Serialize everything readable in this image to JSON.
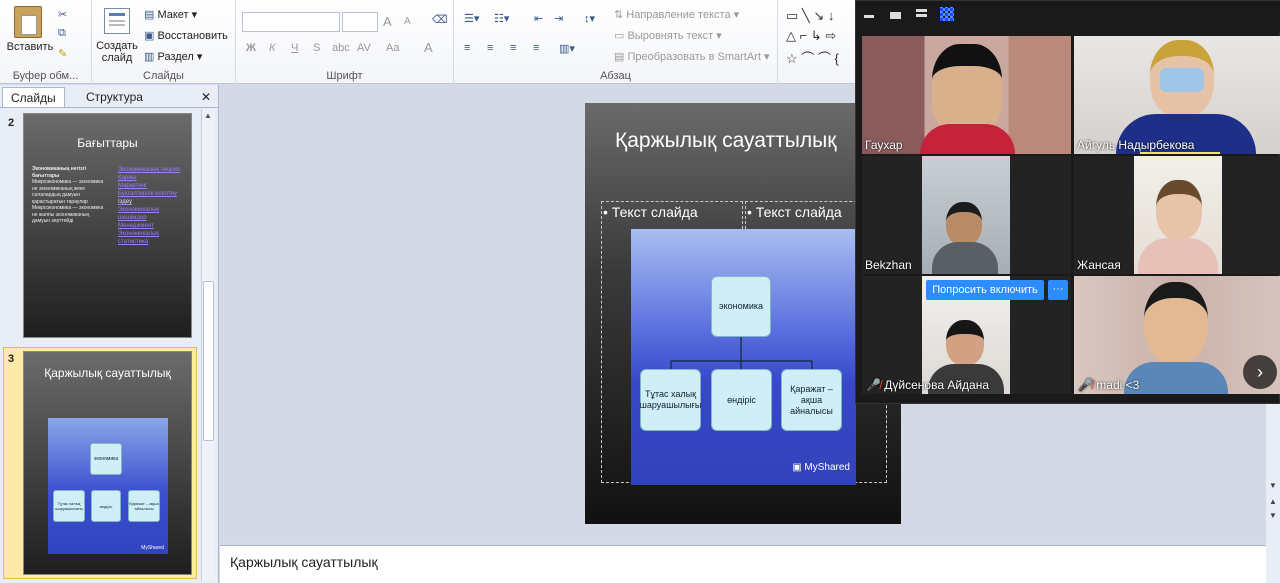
{
  "ribbon": {
    "paste_label": "Вставить",
    "clipboard_group": "Буфер обм...",
    "new_slide_label": "Создать слайд",
    "layout_label": "Макет",
    "reset_label": "Восстановить",
    "section_label": "Раздел",
    "slides_group": "Слайды",
    "bold": "Ж",
    "italic": "К",
    "underline": "Ч",
    "strike": "S",
    "shadow": "abc",
    "spacing": "AV",
    "case": "Aa",
    "grow_font": "A",
    "shrink_font": "A",
    "font_group": "Шрифт",
    "text_direction": "Направление текста",
    "align_text": "Выровнять текст",
    "smartart": "Преобразовать в SmartArt",
    "paragraph_group": "Абзац"
  },
  "panel": {
    "tab_slides": "Слайды",
    "tab_outline": "Структура",
    "close": "✕"
  },
  "slides": [
    {
      "number": "2",
      "title": "Бағыттары",
      "bullets_left": [
        "Экономиканың негізгі бағыттары",
        "Микроэкономика — экономика не экономиканың жеке салалардың дамуын қарастыратын тараулар",
        "Микроэкономика — экономика не жалпы экономиканың дамуын зерттейді"
      ],
      "bullets_right": [
        "Экономикалық теория",
        "Қаржы",
        "Маркетинг",
        "Бухгалтерлік есептеу",
        "Іздеу",
        "Экономикалық шешімдер",
        "Менеджмент",
        "Экономикалық статистика"
      ]
    },
    {
      "number": "3",
      "title": "Қаржылық сауаттылық"
    }
  ],
  "slide": {
    "title": "Қаржылық сауаттылық",
    "placeholder_left": "Текст слайда",
    "placeholder_right": "Текст слайда",
    "diagram": {
      "root": "экономика",
      "children": [
        "Тұтас халық шаруашылығы",
        "өндіріс",
        "Қаражат – ақша айналысы"
      ]
    },
    "watermark": "MyShared"
  },
  "notes": {
    "text": "Қаржылық сауаттылық"
  },
  "zoom": {
    "participants": [
      {
        "name": "Гаухар",
        "muted": false
      },
      {
        "name": "Айгуль Надырбекова",
        "muted": false
      },
      {
        "name": "Bekzhan",
        "muted": false
      },
      {
        "name": "Жансая",
        "muted": false
      },
      {
        "name": "Дүйсенова Айдана",
        "muted": true
      },
      {
        "name": "madi <3",
        "muted": true
      }
    ],
    "ask_to_unmute": "Попросить включить",
    "more": "···"
  },
  "colors": {
    "accent": "#2d8cff",
    "slide_bg": "#3a3a3a",
    "node": "#cfeef6"
  }
}
